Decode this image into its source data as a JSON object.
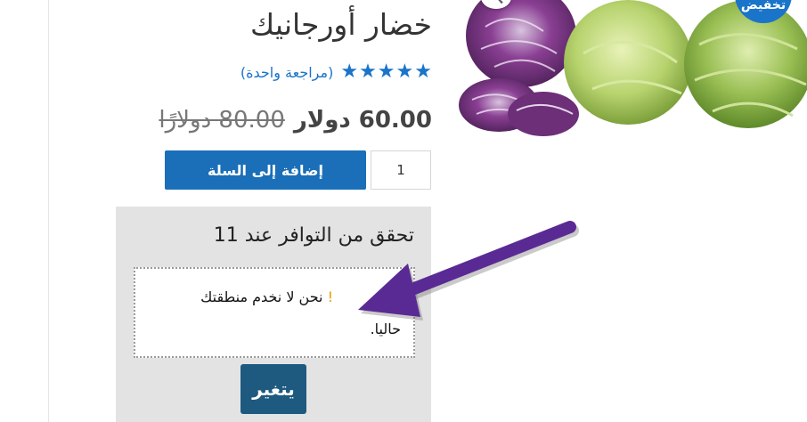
{
  "product": {
    "title": "خضار أورجانيك",
    "rating_stars": 5,
    "rating_max": 5,
    "review_link": "(مراجعة واحدة)",
    "old_price": "80.00 دولارًا",
    "new_price": "60.00 دولار",
    "sale_badge": "تخفيض",
    "image_icon": "magnify-icon"
  },
  "cart": {
    "quantity": "1",
    "add_to_cart_label": "إضافة إلى السلة"
  },
  "availability": {
    "heading": "تحقق من التوافر عند 11",
    "message_mark": "!",
    "message_line1": "نحن لا نخدم منطقتك",
    "message_line2": "حاليا.",
    "change_label": "يتغير"
  },
  "colors": {
    "accent_blue": "#1a6fb8",
    "change_button": "#1e5a80",
    "annotation_arrow": "#5a2a94",
    "box_background": "#e3e3e3"
  }
}
